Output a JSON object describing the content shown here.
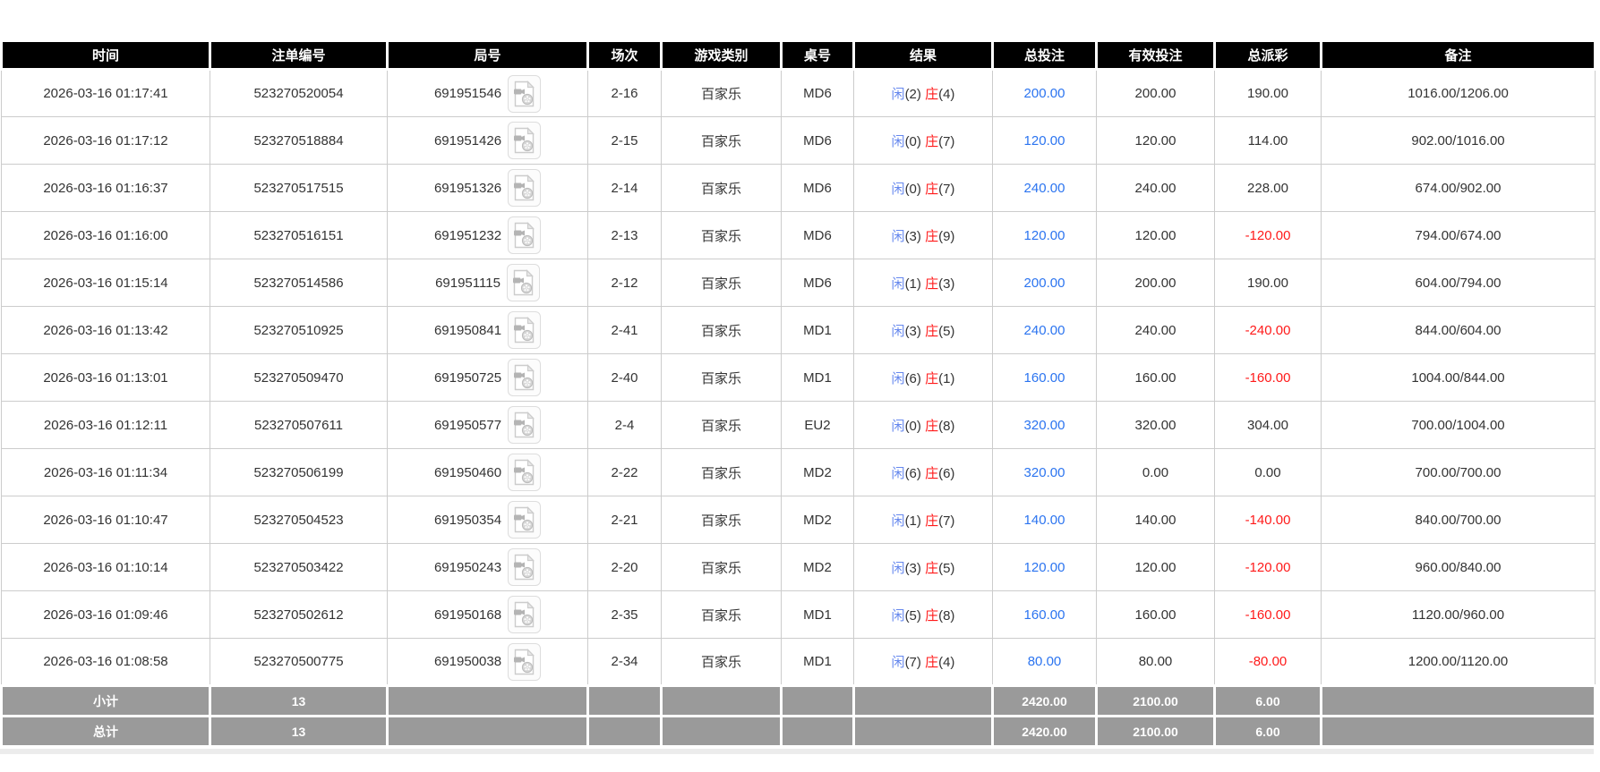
{
  "colors": {
    "header_bg": "#000000",
    "summary_bg": "#9a9a9a",
    "grid_line": "#cccccc",
    "bet_amount_blue": "#2b74f0",
    "player_blue": "#6688ee",
    "banker_red": "#ff1a1a",
    "negative_red": "#ff1a1a"
  },
  "table": {
    "columns": [
      {
        "id": "time",
        "label": "时间"
      },
      {
        "id": "bet_id",
        "label": "注单编号"
      },
      {
        "id": "round_id",
        "label": "局号"
      },
      {
        "id": "session",
        "label": "场次"
      },
      {
        "id": "game_type",
        "label": "游戏类别"
      },
      {
        "id": "table_no",
        "label": "桌号"
      },
      {
        "id": "result",
        "label": "结果"
      },
      {
        "id": "total_bet",
        "label": "总投注"
      },
      {
        "id": "valid_bet",
        "label": "有效投注"
      },
      {
        "id": "total_payout",
        "label": "总派彩"
      },
      {
        "id": "remark",
        "label": "备注"
      }
    ],
    "result_labels": {
      "player": "闲",
      "banker": "庄"
    },
    "icons": {
      "round_video": "broken-video-thumbnail-icon"
    },
    "rows": [
      {
        "time": "2026-03-16 01:17:41",
        "bet_id": "523270520054",
        "round_id": "691951546",
        "session": "2-16",
        "game_type": "百家乐",
        "table_no": "MD6",
        "player_pts": "(2)",
        "banker_pts": "(4)",
        "total_bet": "200.00",
        "valid_bet": "200.00",
        "total_payout": "190.00",
        "remark": "1016.00/1206.00"
      },
      {
        "time": "2026-03-16 01:17:12",
        "bet_id": "523270518884",
        "round_id": "691951426",
        "session": "2-15",
        "game_type": "百家乐",
        "table_no": "MD6",
        "player_pts": "(0)",
        "banker_pts": "(7)",
        "total_bet": "120.00",
        "valid_bet": "120.00",
        "total_payout": "114.00",
        "remark": "902.00/1016.00"
      },
      {
        "time": "2026-03-16 01:16:37",
        "bet_id": "523270517515",
        "round_id": "691951326",
        "session": "2-14",
        "game_type": "百家乐",
        "table_no": "MD6",
        "player_pts": "(0)",
        "banker_pts": "(7)",
        "total_bet": "240.00",
        "valid_bet": "240.00",
        "total_payout": "228.00",
        "remark": "674.00/902.00"
      },
      {
        "time": "2026-03-16 01:16:00",
        "bet_id": "523270516151",
        "round_id": "691951232",
        "session": "2-13",
        "game_type": "百家乐",
        "table_no": "MD6",
        "player_pts": "(3)",
        "banker_pts": "(9)",
        "total_bet": "120.00",
        "valid_bet": "120.00",
        "total_payout": "-120.00",
        "remark": "794.00/674.00"
      },
      {
        "time": "2026-03-16 01:15:14",
        "bet_id": "523270514586",
        "round_id": "691951115",
        "session": "2-12",
        "game_type": "百家乐",
        "table_no": "MD6",
        "player_pts": "(1)",
        "banker_pts": "(3)",
        "total_bet": "200.00",
        "valid_bet": "200.00",
        "total_payout": "190.00",
        "remark": "604.00/794.00"
      },
      {
        "time": "2026-03-16 01:13:42",
        "bet_id": "523270510925",
        "round_id": "691950841",
        "session": "2-41",
        "game_type": "百家乐",
        "table_no": "MD1",
        "player_pts": "(3)",
        "banker_pts": "(5)",
        "total_bet": "240.00",
        "valid_bet": "240.00",
        "total_payout": "-240.00",
        "remark": "844.00/604.00"
      },
      {
        "time": "2026-03-16 01:13:01",
        "bet_id": "523270509470",
        "round_id": "691950725",
        "session": "2-40",
        "game_type": "百家乐",
        "table_no": "MD1",
        "player_pts": "(6)",
        "banker_pts": "(1)",
        "total_bet": "160.00",
        "valid_bet": "160.00",
        "total_payout": "-160.00",
        "remark": "1004.00/844.00"
      },
      {
        "time": "2026-03-16 01:12:11",
        "bet_id": "523270507611",
        "round_id": "691950577",
        "session": "2-4",
        "game_type": "百家乐",
        "table_no": "EU2",
        "player_pts": "(0)",
        "banker_pts": "(8)",
        "total_bet": "320.00",
        "valid_bet": "320.00",
        "total_payout": "304.00",
        "remark": "700.00/1004.00"
      },
      {
        "time": "2026-03-16 01:11:34",
        "bet_id": "523270506199",
        "round_id": "691950460",
        "session": "2-22",
        "game_type": "百家乐",
        "table_no": "MD2",
        "player_pts": "(6)",
        "banker_pts": "(6)",
        "total_bet": "320.00",
        "valid_bet": "0.00",
        "total_payout": "0.00",
        "remark": "700.00/700.00"
      },
      {
        "time": "2026-03-16 01:10:47",
        "bet_id": "523270504523",
        "round_id": "691950354",
        "session": "2-21",
        "game_type": "百家乐",
        "table_no": "MD2",
        "player_pts": "(1)",
        "banker_pts": "(7)",
        "total_bet": "140.00",
        "valid_bet": "140.00",
        "total_payout": "-140.00",
        "remark": "840.00/700.00"
      },
      {
        "time": "2026-03-16 01:10:14",
        "bet_id": "523270503422",
        "round_id": "691950243",
        "session": "2-20",
        "game_type": "百家乐",
        "table_no": "MD2",
        "player_pts": "(3)",
        "banker_pts": "(5)",
        "total_bet": "120.00",
        "valid_bet": "120.00",
        "total_payout": "-120.00",
        "remark": "960.00/840.00"
      },
      {
        "time": "2026-03-16 01:09:46",
        "bet_id": "523270502612",
        "round_id": "691950168",
        "session": "2-35",
        "game_type": "百家乐",
        "table_no": "MD1",
        "player_pts": "(5)",
        "banker_pts": "(8)",
        "total_bet": "160.00",
        "valid_bet": "160.00",
        "total_payout": "-160.00",
        "remark": "1120.00/960.00"
      },
      {
        "time": "2026-03-16 01:08:58",
        "bet_id": "523270500775",
        "round_id": "691950038",
        "session": "2-34",
        "game_type": "百家乐",
        "table_no": "MD1",
        "player_pts": "(7)",
        "banker_pts": "(4)",
        "total_bet": "80.00",
        "valid_bet": "80.00",
        "total_payout": "-80.00",
        "remark": "1200.00/1120.00"
      }
    ],
    "summary": [
      {
        "label": "小计",
        "count": "13",
        "total_bet": "2420.00",
        "valid_bet": "2100.00",
        "total_payout": "6.00"
      },
      {
        "label": "总计",
        "count": "13",
        "total_bet": "2420.00",
        "valid_bet": "2100.00",
        "total_payout": "6.00"
      }
    ]
  }
}
